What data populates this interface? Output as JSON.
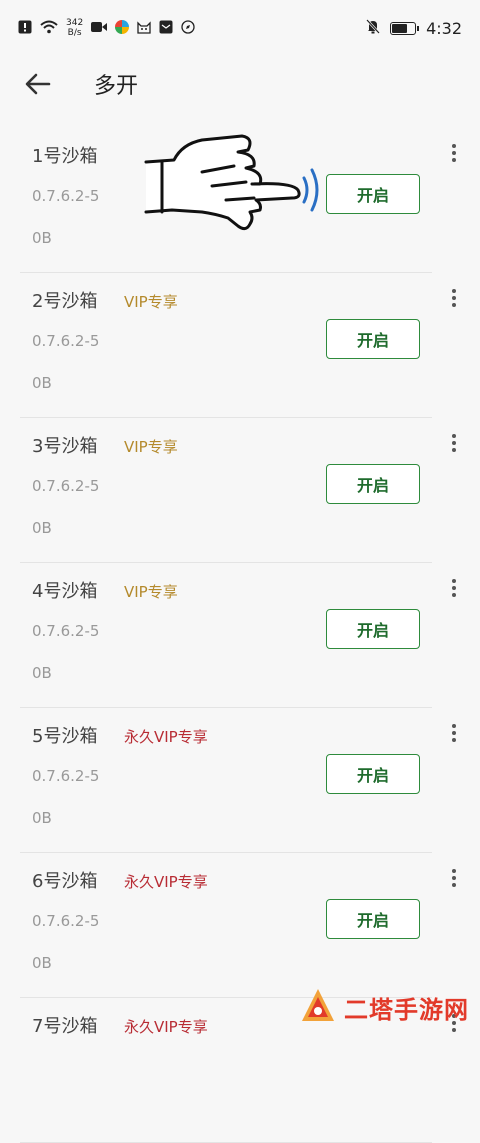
{
  "status_bar": {
    "net_speed_value": "342",
    "net_speed_unit": "B/s",
    "time": "4:32",
    "battery_level": 0.75,
    "icons": [
      "alert-icon",
      "wifi-icon",
      "video-icon",
      "pinwheel-app-icon",
      "cat-app-icon",
      "mail-app-icon",
      "compass-app-icon",
      "mute-icon",
      "battery-icon"
    ]
  },
  "app_bar": {
    "title": "多开",
    "back_icon": "arrow-left-icon"
  },
  "sandboxes": [
    {
      "name": "1号沙箱",
      "badge": "",
      "badge_type": "none",
      "version": "0.7.6.2-5",
      "size": "0B",
      "button": "开启"
    },
    {
      "name": "2号沙箱",
      "badge": "VIP专享",
      "badge_type": "vip",
      "version": "0.7.6.2-5",
      "size": "0B",
      "button": "开启"
    },
    {
      "name": "3号沙箱",
      "badge": "VIP专享",
      "badge_type": "vip",
      "version": "0.7.6.2-5",
      "size": "0B",
      "button": "开启"
    },
    {
      "name": "4号沙箱",
      "badge": "VIP专享",
      "badge_type": "vip",
      "version": "0.7.6.2-5",
      "size": "0B",
      "button": "开启"
    },
    {
      "name": "5号沙箱",
      "badge": "永久VIP专享",
      "badge_type": "forever",
      "version": "0.7.6.2-5",
      "size": "0B",
      "button": "开启"
    },
    {
      "name": "6号沙箱",
      "badge": "永久VIP专享",
      "badge_type": "forever",
      "version": "0.7.6.2-5",
      "size": "0B",
      "button": "开启"
    },
    {
      "name": "7号沙箱",
      "badge": "永久VIP专享",
      "badge_type": "forever",
      "version": "",
      "size": "",
      "button": ""
    }
  ],
  "watermark": {
    "text": "二塔手游网",
    "icon": "tower-logo-icon"
  },
  "colors": {
    "accent_green": "#2e8b3c",
    "vip_gold": "#b48a2c",
    "forever_red": "#b82c34",
    "watermark_red": "#e23a2a"
  }
}
